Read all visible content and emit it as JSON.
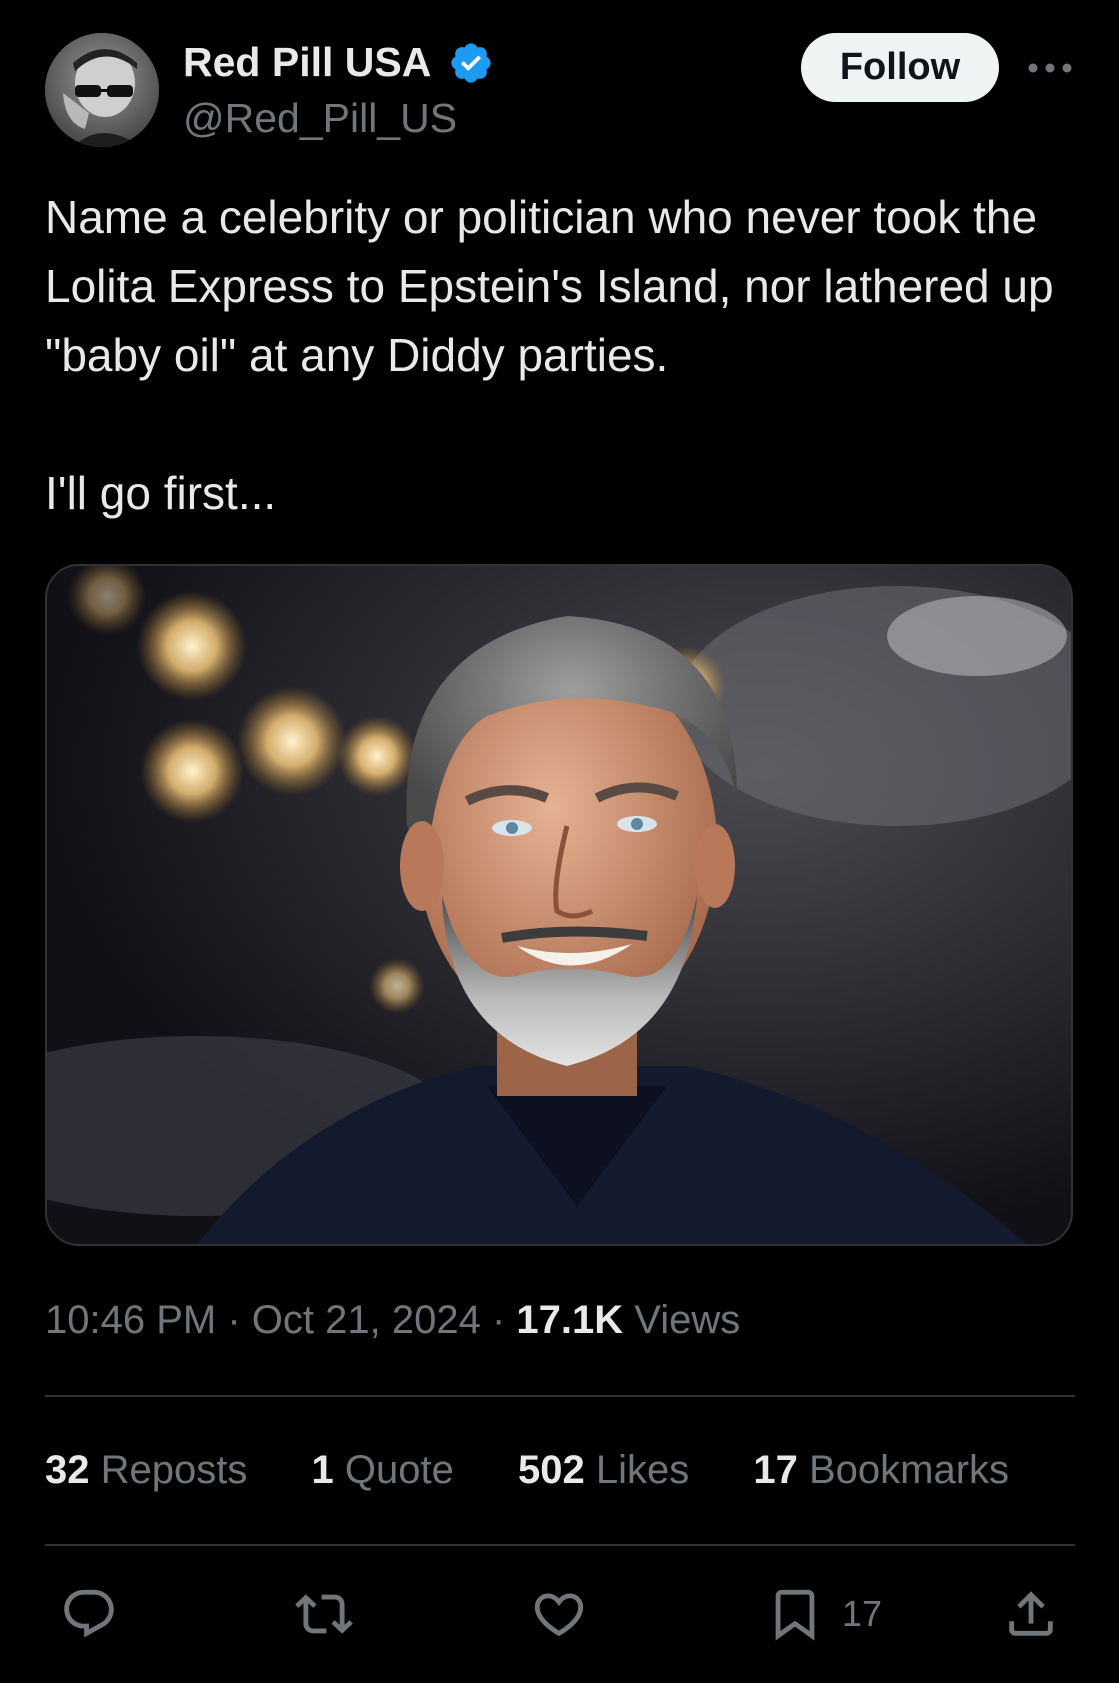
{
  "author": {
    "display_name": "Red Pill USA",
    "handle": "@Red_Pill_US",
    "verified": true,
    "verified_color": "#1d9bf0"
  },
  "header": {
    "follow_label": "Follow",
    "more_icon": "more-horizontal-icon"
  },
  "tweet": {
    "paragraphs": [
      "Name a celebrity or politician who never took the Lolita Express to Epstein's Island, nor lathered up \"baby oil\" at any Diddy parties.",
      "I'll go first..."
    ],
    "media": {
      "kind": "photo",
      "icon": "photo-of-smiling-bearded-man"
    }
  },
  "meta": {
    "time": "10:46 PM",
    "separator": "·",
    "date": "Oct 21, 2024",
    "views_count": "17.1K",
    "views_label": "Views"
  },
  "stats": {
    "reposts_count": "32",
    "reposts_label": "Reposts",
    "quotes_count": "1",
    "quotes_label": "Quote",
    "likes_count": "502",
    "likes_label": "Likes",
    "bookmarks_count": "17",
    "bookmarks_label": "Bookmarks"
  },
  "actions": {
    "reply_icon": "reply-icon",
    "repost_icon": "repost-icon",
    "like_icon": "heart-icon",
    "bookmark_icon": "bookmark-icon",
    "bookmark_count": "17",
    "share_icon": "share-icon"
  },
  "colors": {
    "background": "#000000",
    "text_primary": "#e7e9ea",
    "text_secondary": "#71767b",
    "divider": "#2f3336",
    "follow_bg": "#eff3f4"
  }
}
